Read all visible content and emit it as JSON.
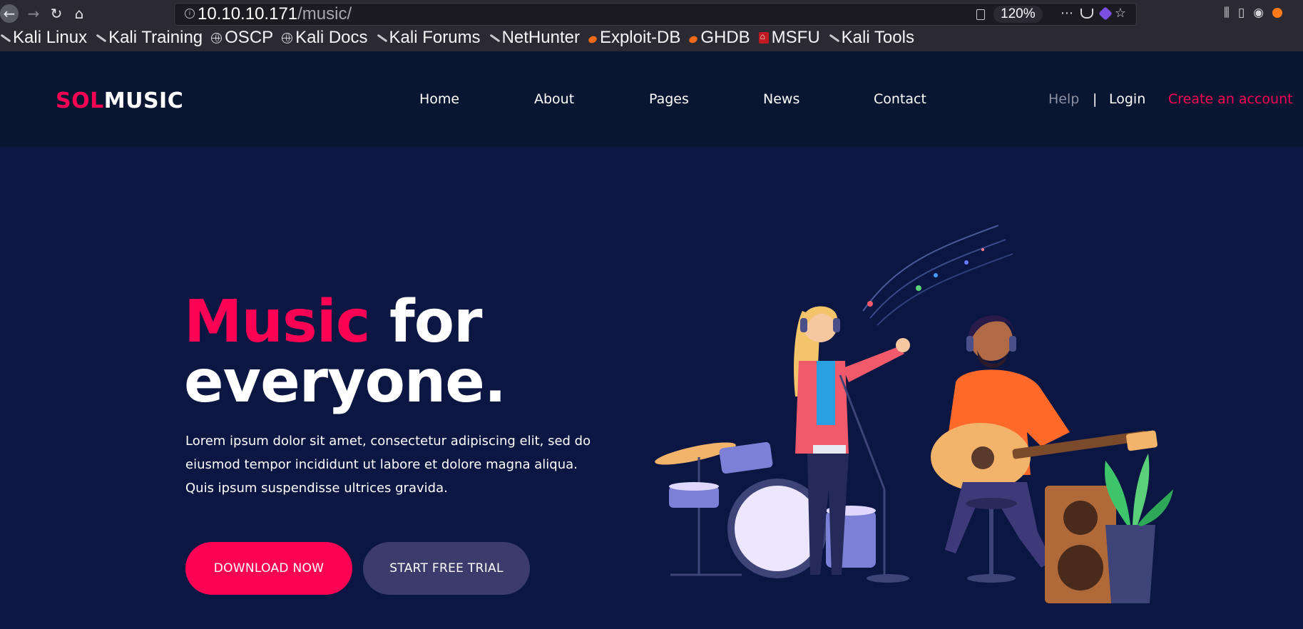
{
  "browser": {
    "url_host": "10.10.10.171",
    "url_path": "/music/",
    "zoom": "120%",
    "bookmarks": [
      {
        "label": "Kali Linux",
        "icon": "kali-dragon-icon"
      },
      {
        "label": "Kali Training",
        "icon": "kali-dragon-icon"
      },
      {
        "label": "OSCP",
        "icon": "globe-icon"
      },
      {
        "label": "Kali Docs",
        "icon": "globe-icon"
      },
      {
        "label": "Kali Forums",
        "icon": "kali-dragon-icon"
      },
      {
        "label": "NetHunter",
        "icon": "kali-dragon-icon"
      },
      {
        "label": "Exploit-DB",
        "icon": "exploit-db-icon"
      },
      {
        "label": "GHDB",
        "icon": "exploit-db-icon"
      },
      {
        "label": "MSFU",
        "icon": "metasploit-icon"
      },
      {
        "label": "Kali Tools",
        "icon": "kali-dragon-icon"
      }
    ]
  },
  "site": {
    "logo_part1": "SOL",
    "logo_part2": "MUSIC",
    "nav": [
      "Home",
      "About",
      "Pages",
      "News",
      "Contact"
    ],
    "help": "Help",
    "separator": "|",
    "login": "Login",
    "create_account": "Create an account"
  },
  "hero": {
    "headline_pink": "Music",
    "headline_white1": " for",
    "headline_white2": "everyone.",
    "lead_line1": "Lorem ipsum dolor sit amet, consectetur adipiscing elit, sed do",
    "lead_line2": "eiusmod tempor incididunt ut labore et dolore magna aliqua.",
    "lead_line3": "Quis ipsum suspendisse ultrices gravida.",
    "download_label": "DOWNLOAD NOW",
    "trial_label": "START FREE TRIAL"
  },
  "colors": {
    "accent": "#fc0254",
    "header_bg": "#091631",
    "hero_bg": "#0b1642",
    "secondary_button": "#3b3c6c"
  }
}
